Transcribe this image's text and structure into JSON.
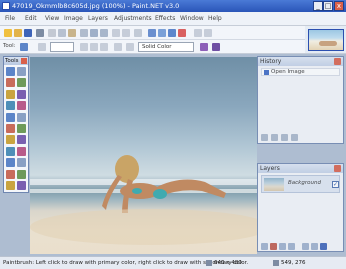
{
  "window": {
    "title": "47019_Okmmlb8c605d.jpg (100%) - Paint.NET v3.0",
    "minimize_glyph": "_",
    "maximize_glyph": "□",
    "close_glyph": "x"
  },
  "menu": [
    "File",
    "Edit",
    "View",
    "Image",
    "Layers",
    "Adjustments",
    "Effects",
    "Window",
    "Help"
  ],
  "toolbar": {
    "tool_label": "Tool:",
    "brush_select": "Solid Color"
  },
  "tools_panel": {
    "title": "Tools",
    "tools": [
      "rectangle-select-tool-icon",
      "move-selection-tool-icon",
      "lasso-select-tool-icon",
      "move-selected-pixels-tool-icon",
      "ellipse-select-tool-icon",
      "zoom-tool-icon",
      "magic-wand-tool-icon",
      "pan-tool-icon",
      "paint-bucket-tool-icon",
      "gradient-tool-icon",
      "paintbrush-tool-icon",
      "eraser-tool-icon",
      "pencil-tool-icon",
      "color-picker-tool-icon",
      "clone-stamp-tool-icon",
      "recolor-tool-icon",
      "text-tool-icon",
      "line-curve-tool-icon",
      "rectangle-tool-icon",
      "rounded-rectangle-tool-icon",
      "ellipse-tool-icon",
      "freeform-shape-tool-icon"
    ]
  },
  "history_panel": {
    "title": "History",
    "items": [
      "Open Image"
    ]
  },
  "layers_panel": {
    "title": "Layers",
    "layers": [
      {
        "name": "Background",
        "visible": true
      }
    ]
  },
  "status": {
    "hint": "Paintbrush: Left click to draw with primary color, right click to draw with secondary color.",
    "image_size": "640 x 480",
    "cursor_position": "549, 276"
  },
  "colors": {
    "title_bar": "#2a55b8",
    "workspace": "#aebdd1",
    "panel_border": "#6f86b0",
    "close_red": "#d9604a"
  }
}
